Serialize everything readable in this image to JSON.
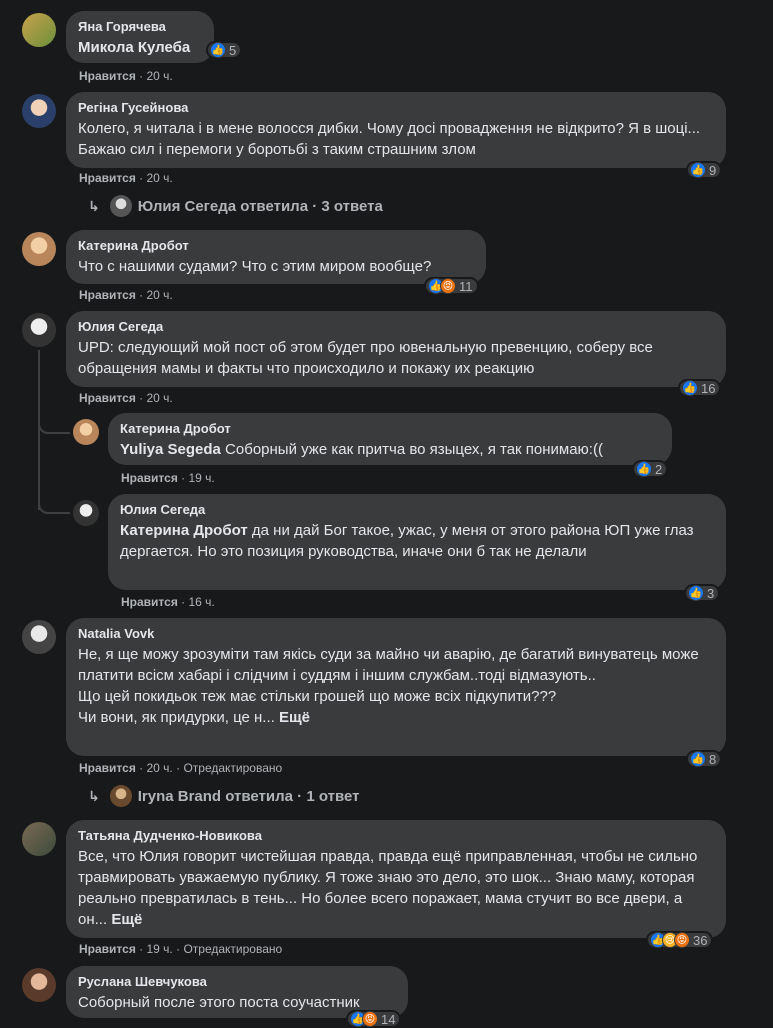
{
  "comments": [
    {
      "author": "Яна Горячева",
      "mention": "Микола Кулеба",
      "text": "",
      "like": "Нравится",
      "time": "20 ч.",
      "reactions": "5"
    },
    {
      "author": "Регіна Гусейнова",
      "text": "Колего, я читала і в мене волосся дибки. Чому досі провадження не відкрито? Я в шоці... Бажаю сил і перемоги у боротьбі з таким страшним злом",
      "like": "Нравится",
      "time": "20 ч.",
      "reactions": "9",
      "replies": "Юлия Сегеда ответила · 3 ответа"
    },
    {
      "author": "Катерина Дробот",
      "text": "Что с нашими судами? Что с этим миром вообще?",
      "like": "Нравится",
      "time": "20 ч.",
      "reactions": "11"
    },
    {
      "author": "Юлия Сегеда",
      "text": "UPD: следующий мой пост об этом будет про ювенальную превенцию, соберу все обращения мамы и факты что происходило и покажу их реакцию",
      "like": "Нравится",
      "time": "20 ч.",
      "reactions": "16"
    },
    {
      "author": "Катерина Дробот",
      "mention": "Yuliya Segeda",
      "text": " Соборный уже как притча во языцех, я так понимаю:((",
      "like": "Нравится",
      "time": "19 ч.",
      "reactions": "2"
    },
    {
      "author": "Юлия Сегеда",
      "mention": "Катерина Дробот",
      "text": " да ни дай Бог такое, ужас, у меня от этого района ЮП уже глаз дергается. Но это позиция руководства, иначе они б так не делали",
      "like": "Нравится",
      "time": "16 ч.",
      "reactions": "3"
    },
    {
      "author": "Natalia Vovk",
      "text": "Не, я ще можу зрозуміти там якісь суди за майно чи аварію, де багатий винуватець може платити всісм хабарі і слідчим і суддям і іншим службам..тоді відмазують..\nЩо цей покидьок теж має стільки грошей що може всіх підкупити???\nЧи вони, як придурки, це н...",
      "more": "Ещё",
      "like": "Нравится",
      "time": "20 ч.",
      "edited": "Отредактировано",
      "reactions": "8",
      "replies": "Iryna Brand ответила · 1 ответ"
    },
    {
      "author": "Татьяна Дудченко-Новикова",
      "text": "Все, что Юлия говорит чистейшая правда, правда ещё приправленная, чтобы не сильно травмировать уважаемую публику. Я тоже знаю это дело, это шок... Знаю маму, которая реально превратилась в тень... Но более всего поражает, мама стучит во все двери, а он...",
      "more": "Ещё",
      "like": "Нравится",
      "time": "19 ч.",
      "edited": "Отредактировано",
      "reactions": "36"
    },
    {
      "author": "Руслана Шевчукова",
      "text": "Соборный после этого поста соучастник",
      "reactions": "14"
    }
  ],
  "colors": {
    "background": "#18191a",
    "bubble": "#3a3b3c",
    "like": "#1877f2",
    "angry": "#e9710f",
    "sad": "#f7b125"
  }
}
